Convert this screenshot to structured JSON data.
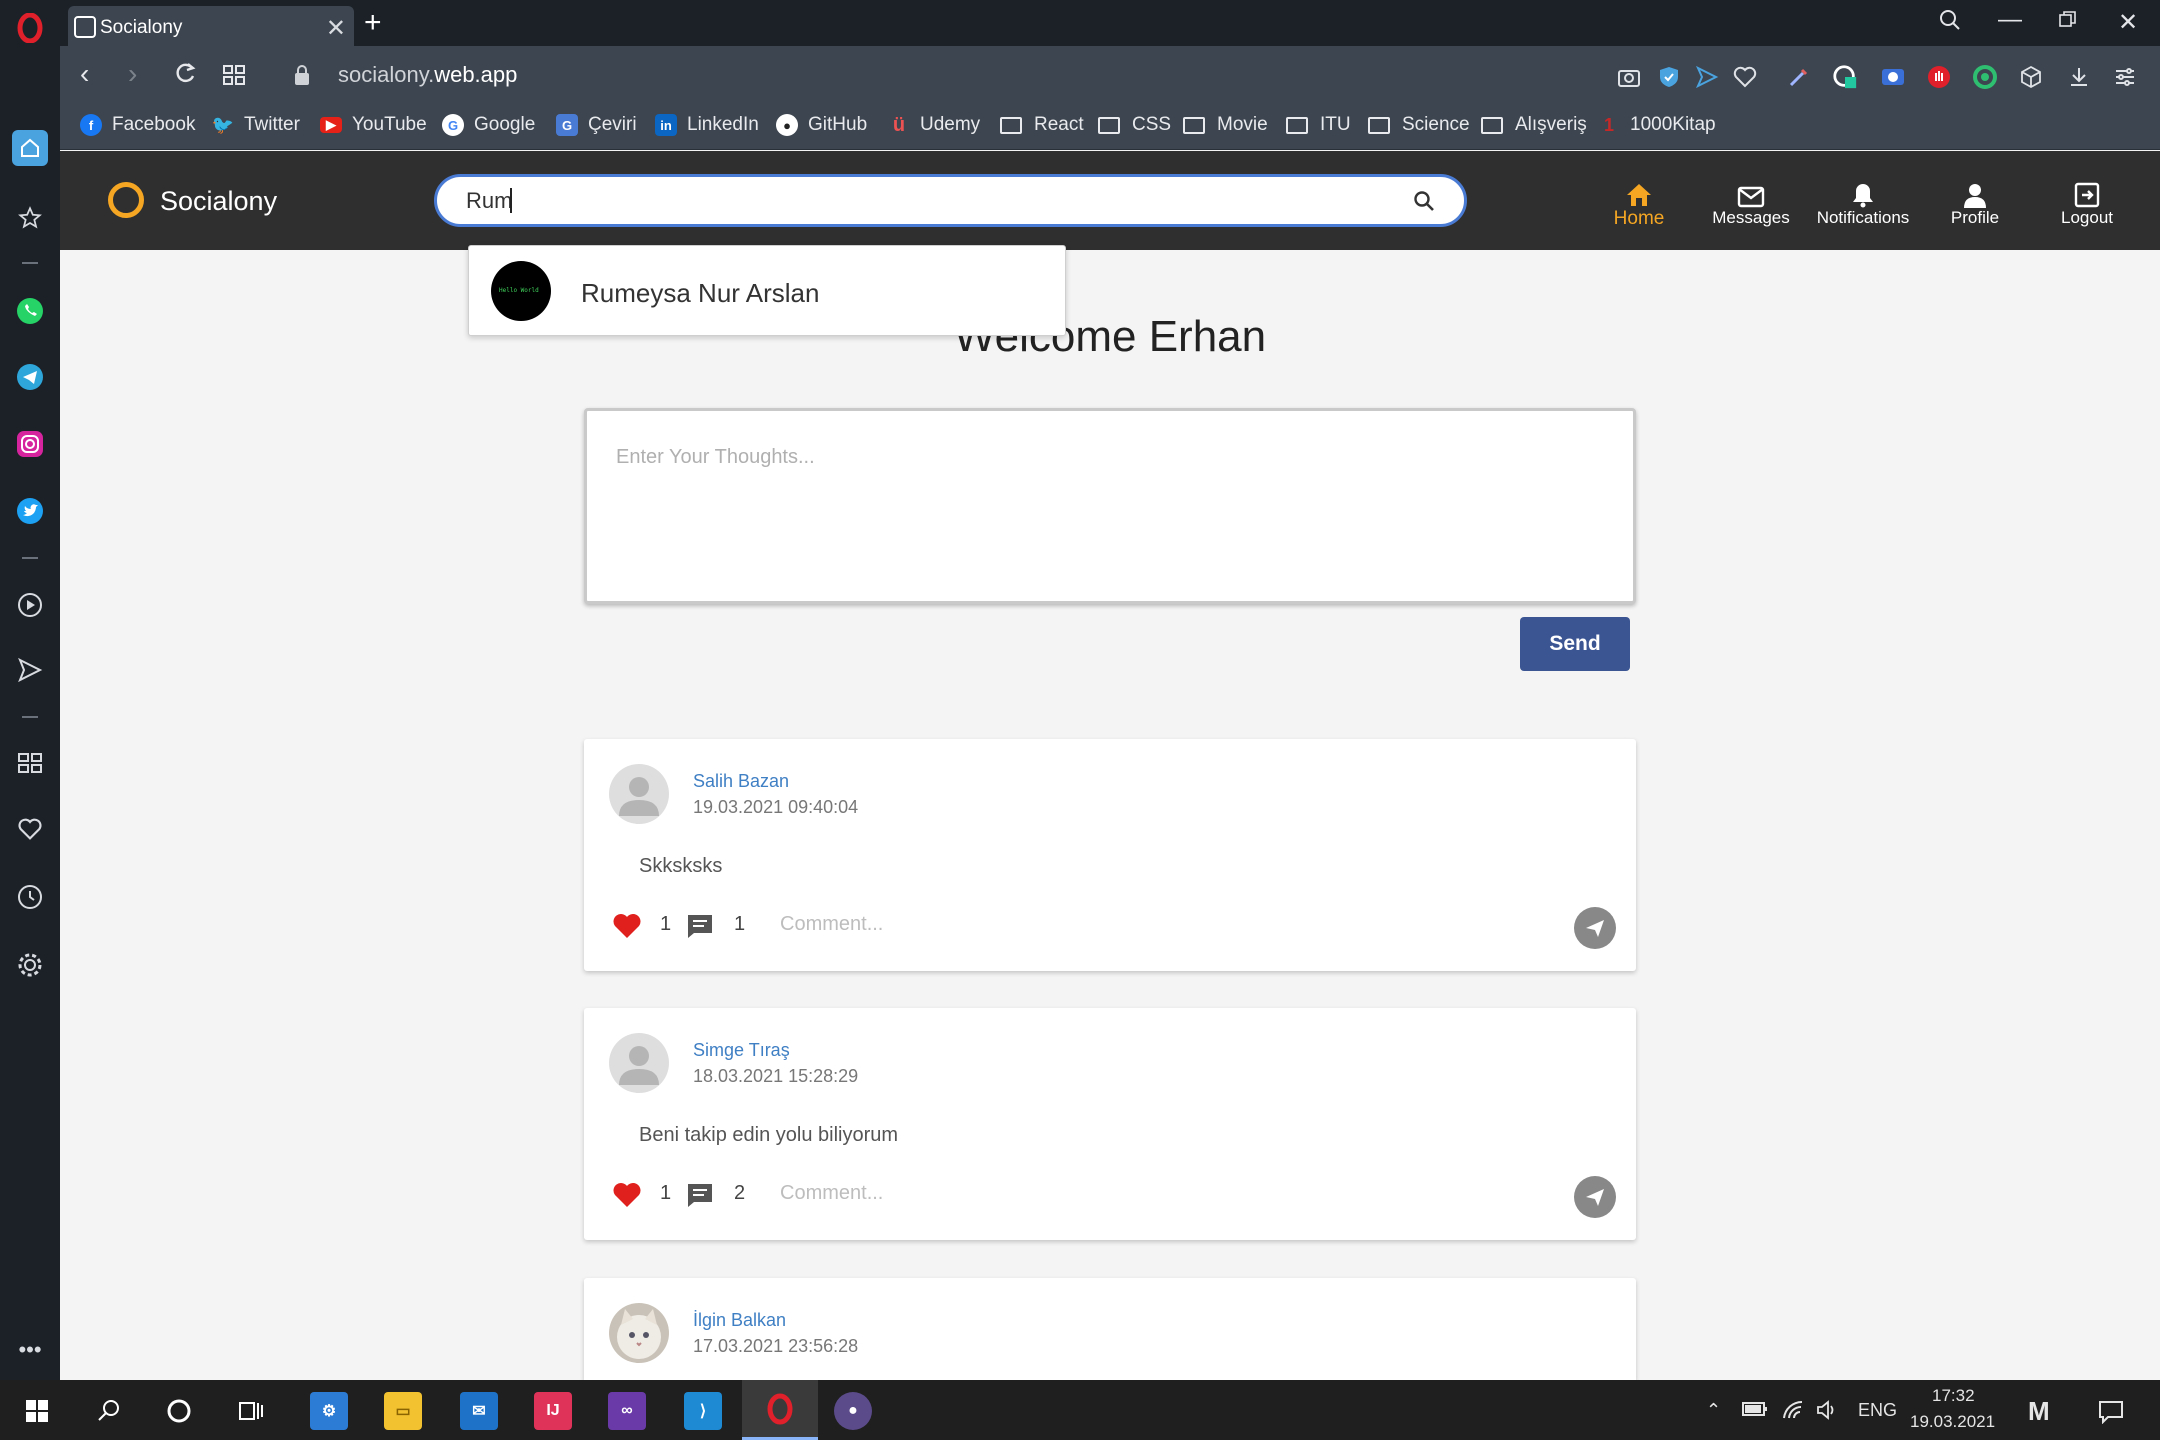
{
  "browser": {
    "tab_title": "Socialony",
    "url_host_prefix": "socialony.",
    "url_host_domain": "web.app"
  },
  "bookmarks": [
    {
      "label": "Facebook",
      "icon": "facebook-icon"
    },
    {
      "label": "Twitter",
      "icon": "twitter-icon"
    },
    {
      "label": "YouTube",
      "icon": "youtube-icon"
    },
    {
      "label": "Google",
      "icon": "google-icon"
    },
    {
      "label": "Çeviri",
      "icon": "translate-icon"
    },
    {
      "label": "LinkedIn",
      "icon": "linkedin-icon"
    },
    {
      "label": "GitHub",
      "icon": "github-icon"
    },
    {
      "label": "Udemy",
      "icon": "udemy-icon"
    },
    {
      "label": "React",
      "icon": "folder-icon"
    },
    {
      "label": "CSS",
      "icon": "folder-icon"
    },
    {
      "label": "Movie",
      "icon": "folder-icon"
    },
    {
      "label": "ITU",
      "icon": "folder-icon"
    },
    {
      "label": "Science",
      "icon": "folder-icon"
    },
    {
      "label": "Alışveriş",
      "icon": "folder-icon"
    },
    {
      "label": "1000Kitap",
      "icon": "book-icon"
    }
  ],
  "app": {
    "name": "Socialony",
    "accent": "#f5a623",
    "search": {
      "value": "Rum"
    },
    "nav": [
      {
        "label": "Home",
        "icon": "home-icon",
        "active": true
      },
      {
        "label": "Messages",
        "icon": "mail-icon"
      },
      {
        "label": "Notifications",
        "icon": "bell-icon"
      },
      {
        "label": "Profile",
        "icon": "person-icon"
      },
      {
        "label": "Logout",
        "icon": "logout-icon"
      }
    ],
    "search_results": [
      {
        "name": "Rumeysa Nur Arslan",
        "avatar_text": "Hello World"
      }
    ]
  },
  "main": {
    "welcome": "Welcome Erhan",
    "thought_placeholder": "Enter Your Thoughts...",
    "send_label": "Send",
    "comment_placeholder": "Comment...",
    "posts": [
      {
        "author": "Salih Bazan",
        "date": "19.03.2021 09:40:04",
        "text": "Skksksks",
        "likes": "1",
        "comments": "1"
      },
      {
        "author": "Simge Tıraş",
        "date": "18.03.2021 15:28:29",
        "text": "Beni takip edin yolu biliyorum",
        "likes": "1",
        "comments": "2"
      },
      {
        "author": "İlgin Balkan",
        "date": "17.03.2021 23:56:28"
      }
    ]
  },
  "taskbar": {
    "language": "ENG",
    "time": "17:32",
    "date": "19.03.2021"
  }
}
